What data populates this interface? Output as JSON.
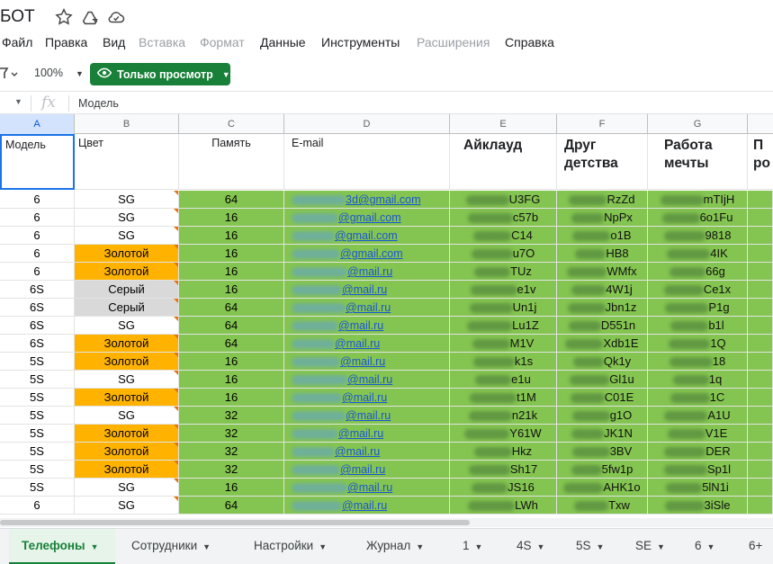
{
  "doc": {
    "title": "БОТ"
  },
  "menu": [
    {
      "label": "Файл",
      "disabled": false
    },
    {
      "label": "Правка",
      "disabled": false
    },
    {
      "label": "Вид",
      "disabled": false
    },
    {
      "label": "Вставка",
      "disabled": true
    },
    {
      "label": "Формат",
      "disabled": true
    },
    {
      "label": "Данные",
      "disabled": false
    },
    {
      "label": "Инструменты",
      "disabled": false
    },
    {
      "label": "Расширения",
      "disabled": true
    },
    {
      "label": "Справка",
      "disabled": false
    }
  ],
  "toolbar": {
    "zoom": "100%",
    "view_only_label": "Только просмотр"
  },
  "formula_bar": {
    "fx": "fx",
    "value": "Модель"
  },
  "columns": [
    "A",
    "B",
    "C",
    "D",
    "E",
    "F",
    "G"
  ],
  "headers": {
    "a": "Модель",
    "b": "Цвет",
    "c": "Память",
    "d": "E-mail",
    "e": "Айклауд",
    "f": "Друг\nдетства",
    "g": "Работа\nмечты",
    "h": "П\nро"
  },
  "rows": [
    {
      "model": "6",
      "color": "SG",
      "color_type": "white",
      "memory": "64",
      "email_tail": "3d@gmail.com",
      "icloud_tail": "U3FG",
      "friend_tail": "RzZd",
      "job_tail": "mTIjH"
    },
    {
      "model": "6",
      "color": "SG",
      "color_type": "white",
      "memory": "16",
      "email_tail": "@gmail.com",
      "icloud_tail": "c57b",
      "friend_tail": "NpPx",
      "job_tail": "6o1Fu"
    },
    {
      "model": "6",
      "color": "SG",
      "color_type": "white",
      "memory": "16",
      "email_tail": "@gmail.com",
      "icloud_tail": "C14",
      "friend_tail": "o1B",
      "job_tail": "9818"
    },
    {
      "model": "6",
      "color": "Золотой",
      "color_type": "gold",
      "memory": "16",
      "email_tail": "@gmail.com",
      "icloud_tail": "u7O",
      "friend_tail": "HB8",
      "job_tail": "4IK"
    },
    {
      "model": "6",
      "color": "Золотой",
      "color_type": "gold",
      "memory": "16",
      "email_tail": "@mail.ru",
      "icloud_tail": "TUz",
      "friend_tail": "WMfx",
      "job_tail": "66g"
    },
    {
      "model": "6S",
      "color": "Серый",
      "color_type": "gray",
      "memory": "16",
      "email_tail": "@mail.ru",
      "icloud_tail": "e1v",
      "friend_tail": "4W1j",
      "job_tail": "Ce1x"
    },
    {
      "model": "6S",
      "color": "Серый",
      "color_type": "gray",
      "memory": "64",
      "email_tail": "@mail.ru",
      "icloud_tail": "Un1j",
      "friend_tail": "Jbn1z",
      "job_tail": "P1g"
    },
    {
      "model": "6S",
      "color": "SG",
      "color_type": "white",
      "memory": "64",
      "email_tail": "@mail.ru",
      "icloud_tail": "Lu1Z",
      "friend_tail": "D551n",
      "job_tail": "b1l"
    },
    {
      "model": "6S",
      "color": "Золотой",
      "color_type": "gold",
      "memory": "64",
      "email_tail": "@mail.ru",
      "icloud_tail": "M1V",
      "friend_tail": "Xdb1E",
      "job_tail": "1Q"
    },
    {
      "model": "5S",
      "color": "Золотой",
      "color_type": "gold",
      "memory": "16",
      "email_tail": "@mail.ru",
      "icloud_tail": "k1s",
      "friend_tail": "Qk1y",
      "job_tail": "18"
    },
    {
      "model": "5S",
      "color": "SG",
      "color_type": "white",
      "memory": "16",
      "email_tail": "@mail.ru",
      "icloud_tail": "e1u",
      "friend_tail": "Gl1u",
      "job_tail": "1q"
    },
    {
      "model": "5S",
      "color": "Золотой",
      "color_type": "gold",
      "memory": "16",
      "email_tail": "@mail.ru",
      "icloud_tail": "t1M",
      "friend_tail": "C01E",
      "job_tail": "1C"
    },
    {
      "model": "5S",
      "color": "SG",
      "color_type": "white",
      "memory": "32",
      "email_tail": "@mail.ru",
      "icloud_tail": "n21k",
      "friend_tail": "g1O",
      "job_tail": "A1U"
    },
    {
      "model": "5S",
      "color": "Золотой",
      "color_type": "gold",
      "memory": "32",
      "email_tail": "@mail.ru",
      "icloud_tail": "Y61W",
      "friend_tail": "JK1N",
      "job_tail": "V1E"
    },
    {
      "model": "5S",
      "color": "Золотой",
      "color_type": "gold",
      "memory": "32",
      "email_tail": "@mail.ru",
      "icloud_tail": "Hkz",
      "friend_tail": "3BV",
      "job_tail": "DER"
    },
    {
      "model": "5S",
      "color": "Золотой",
      "color_type": "gold",
      "memory": "32",
      "email_tail": "@mail.ru",
      "icloud_tail": "Sh17",
      "friend_tail": "5fw1p",
      "job_tail": "Sp1l"
    },
    {
      "model": "5S",
      "color": "SG",
      "color_type": "white",
      "memory": "16",
      "email_tail": "@mail.ru",
      "icloud_tail": "JS16",
      "friend_tail": "AHK1o",
      "job_tail": "5lN1i"
    },
    {
      "model": "6",
      "color": "SG",
      "color_type": "white",
      "memory": "64",
      "email_tail": "@mail.ru",
      "icloud_tail": "LWh",
      "friend_tail": "Txw",
      "job_tail": "3iSle"
    }
  ],
  "tabs": [
    {
      "label": "Телефоны",
      "active": true
    },
    {
      "label": "Сотрудники",
      "active": false
    },
    {
      "label": "Настройки",
      "active": false
    },
    {
      "label": "Журнал",
      "active": false
    },
    {
      "label": "1",
      "active": false
    },
    {
      "label": "4S",
      "active": false
    },
    {
      "label": "5S",
      "active": false
    },
    {
      "label": "SE",
      "active": false
    },
    {
      "label": "6",
      "active": false
    },
    {
      "label": "6+",
      "active": false
    }
  ],
  "colors": {
    "green_fill": "#84c450",
    "gold_fill": "#ffb300",
    "gray_fill": "#d9d9d9",
    "brand_green": "#188038",
    "link_blue": "#1a56d6"
  }
}
